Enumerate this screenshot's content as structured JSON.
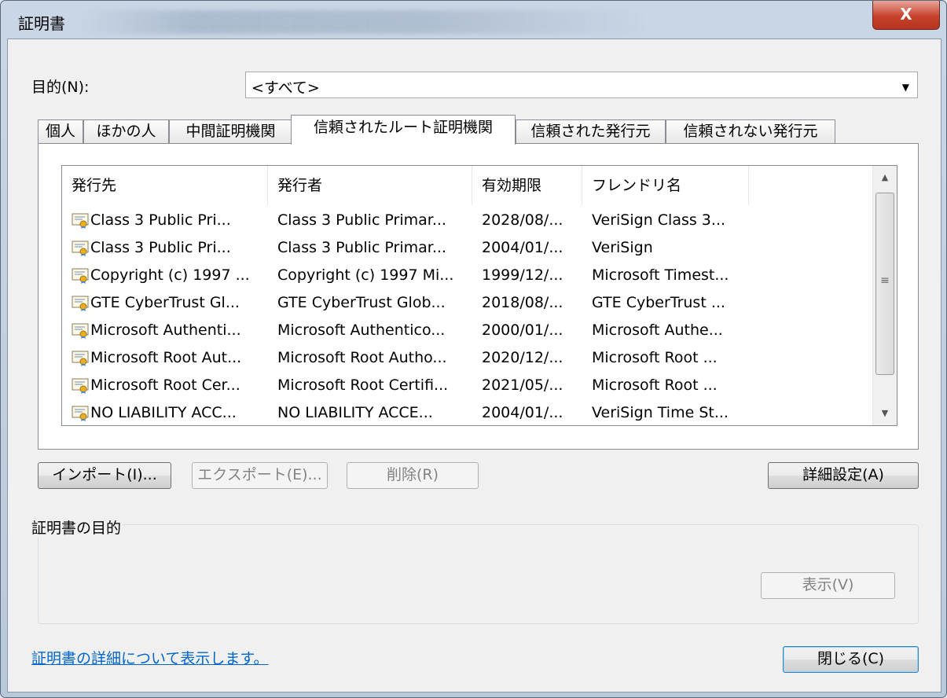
{
  "window": {
    "title": "証明書",
    "close_label": "X"
  },
  "purpose": {
    "label": "目的(N):",
    "value": "<すべて>"
  },
  "tabs": [
    {
      "label": "個人"
    },
    {
      "label": "ほかの人"
    },
    {
      "label": "中間証明機関"
    },
    {
      "label": "信頼されたルート証明機関",
      "active": true
    },
    {
      "label": "信頼された発行元"
    },
    {
      "label": "信頼されない発行元"
    }
  ],
  "list": {
    "columns": [
      "発行先",
      "発行者",
      "有効期限",
      "フレンドリ名"
    ],
    "rows": [
      [
        "Class 3 Public Pri...",
        "Class 3 Public Primar...",
        "2028/08/...",
        "VeriSign Class 3..."
      ],
      [
        "Class 3 Public Pri...",
        "Class 3 Public Primar...",
        "2004/01/...",
        "VeriSign"
      ],
      [
        "Copyright (c) 1997 ...",
        "Copyright (c) 1997 Mi...",
        "1999/12/...",
        "Microsoft Timest..."
      ],
      [
        "GTE CyberTrust Gl...",
        "GTE CyberTrust Glob...",
        "2018/08/...",
        "GTE CyberTrust ..."
      ],
      [
        "Microsoft Authenti...",
        "Microsoft Authentico...",
        "2000/01/...",
        "Microsoft Authe..."
      ],
      [
        "Microsoft Root Aut...",
        "Microsoft Root Autho...",
        "2020/12/...",
        "Microsoft Root ..."
      ],
      [
        "Microsoft Root Cer...",
        "Microsoft Root Certifi...",
        "2021/05/...",
        "Microsoft Root ..."
      ],
      [
        "NO LIABILITY ACC...",
        "NO LIABILITY ACCE...",
        "2004/01/...",
        "VeriSign Time St..."
      ]
    ],
    "icon": "certificate-icon"
  },
  "buttons": {
    "import": "インポート(I)...",
    "export": "エクスポート(E)...",
    "delete": "削除(R)",
    "advanced": "詳細設定(A)",
    "view": "表示(V)",
    "close": "閉じる(C)"
  },
  "purpose_group": {
    "label": "証明書の目的"
  },
  "link": "証明書の詳細について表示します。",
  "colors": {
    "link": "#0066cc",
    "close_button": "#c7422c"
  }
}
